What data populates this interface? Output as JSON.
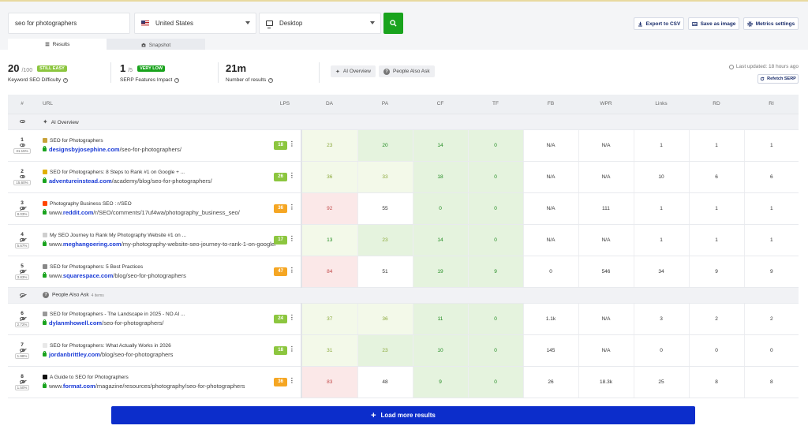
{
  "search": {
    "query": "seo for photographers",
    "country": "United States",
    "device": "Desktop"
  },
  "toolbar": {
    "export_csv": "Export to CSV",
    "save_image": "Save as image",
    "metrics_settings": "Metrics settings"
  },
  "tabs": [
    {
      "label": "Results",
      "active": true
    },
    {
      "label": "Snapshot",
      "active": false
    }
  ],
  "summary": {
    "kd": {
      "value": "20",
      "suffix": "/100",
      "badge": "STILL EASY",
      "badge_color": "#8cc63f",
      "label": "Keyword SEO Difficulty"
    },
    "serp": {
      "value": "1",
      "suffix": "/5",
      "badge": "VERY LOW",
      "badge_color": "#19a31d",
      "label": "SERP Features Impact"
    },
    "results": {
      "value": "21m",
      "label": "Number of results"
    },
    "chips": [
      "AI Overview",
      "People Also Ask"
    ],
    "last_updated": "Last updated: 18 hours ago",
    "refetch": "Refetch SERP"
  },
  "columns": [
    "#",
    "URL",
    "LPS",
    "DA",
    "PA",
    "CF",
    "TF",
    "FB",
    "WPR",
    "Links",
    "RD",
    "RI"
  ],
  "groups": {
    "ai_overview": "AI Overview",
    "people_also_ask": "People Also Ask",
    "paa_count": "4 items"
  },
  "rows": [
    {
      "pos": "1",
      "ctr": "31.15%",
      "visible": true,
      "favicon_color": "#c8a23a",
      "title": "SEO for Photographers",
      "domain": "designsbyjosephine.com",
      "prefix": "",
      "path": "/seo-for-photographers/",
      "lps": "18",
      "lps_color": "#8cc63f",
      "da": "23",
      "pa": "20",
      "cf": "14",
      "tf": "0",
      "fb": "N/A",
      "wpr": "N/A",
      "links": "1",
      "rd": "1",
      "ri": "1"
    },
    {
      "pos": "2",
      "ctr": "15.60%",
      "visible": true,
      "favicon_color": "#e0b000",
      "title": "SEO for Photographers: 8 Steps to Rank #1 on Google + ...",
      "domain": "adventureinstead.com",
      "prefix": "",
      "path": "/academy/blog/seo-for-photographers/",
      "lps": "26",
      "lps_color": "#8cc63f",
      "da": "36",
      "pa": "33",
      "cf": "18",
      "tf": "0",
      "fb": "N/A",
      "wpr": "N/A",
      "links": "10",
      "rd": "6",
      "ri": "6"
    },
    {
      "pos": "3",
      "ctr": "8.03%",
      "visible": false,
      "favicon_color": "#ff4500",
      "title": "Photography Business SEO : r/SEO",
      "domain": "reddit.com",
      "prefix": "www.",
      "path": "/r/SEO/comments/17uf4wa/photography_business_seo/",
      "lps": "36",
      "lps_color": "#f5a623",
      "da": "92",
      "pa": "55",
      "cf": "0",
      "tf": "0",
      "fb": "N/A",
      "wpr": "111",
      "links": "1",
      "rd": "1",
      "ri": "1"
    },
    {
      "pos": "4",
      "ctr": "5.67%",
      "visible": false,
      "favicon_color": "#cfcfcf",
      "title": "My SEO Journey to Rank My Photography Website #1 on ...",
      "domain": "meghangoering.com",
      "prefix": "www.",
      "path": "/my-photography-website-seo-journey-to-rank-1-on-google/",
      "lps": "17",
      "lps_color": "#8cc63f",
      "da": "13",
      "pa": "23",
      "cf": "14",
      "tf": "0",
      "fb": "N/A",
      "wpr": "N/A",
      "links": "1",
      "rd": "1",
      "ri": "1"
    },
    {
      "pos": "5",
      "ctr": "3.83%",
      "visible": false,
      "favicon_color": "#888888",
      "title": "SEO for Photographers: 5 Best Practices",
      "domain": "squarespace.com",
      "prefix": "www.",
      "path": "/blog/seo-for-photographers",
      "lps": "47",
      "lps_color": "#f5a623",
      "da": "84",
      "pa": "51",
      "cf": "19",
      "tf": "9",
      "fb": "0",
      "wpr": "546",
      "links": "34",
      "rd": "9",
      "ri": "9"
    },
    {
      "pos": "6",
      "ctr": "2.72%",
      "visible": false,
      "favicon_color": "#999999",
      "title": "SEO for Photographers - The Landscape in 2025 - NO AI ...",
      "domain": "dylanmhowell.com",
      "prefix": "",
      "path": "/seo-for-photographers/",
      "lps": "24",
      "lps_color": "#8cc63f",
      "da": "37",
      "pa": "36",
      "cf": "11",
      "tf": "0",
      "fb": "1.1k",
      "wpr": "N/A",
      "links": "3",
      "rd": "2",
      "ri": "2"
    },
    {
      "pos": "7",
      "ctr": "1.98%",
      "visible": false,
      "favicon_color": "#e8e8e8",
      "title": "SEO for Photographers: What Actually Works in 2026",
      "domain": "jordanbrittley.com",
      "prefix": "",
      "path": "/blog/seo-for-photographers",
      "lps": "18",
      "lps_color": "#8cc63f",
      "da": "31",
      "pa": "23",
      "cf": "10",
      "tf": "0",
      "fb": "145",
      "wpr": "N/A",
      "links": "0",
      "rd": "0",
      "ri": "0"
    },
    {
      "pos": "8",
      "ctr": "1.50%",
      "visible": false,
      "favicon_color": "#111111",
      "title": "A Guide to SEO for Photographers",
      "domain": "format.com",
      "prefix": "www.",
      "path": "/magazine/resources/photography/seo-for-photographers",
      "lps": "36",
      "lps_color": "#f5a623",
      "da": "83",
      "pa": "48",
      "cf": "9",
      "tf": "0",
      "fb": "26",
      "wpr": "18.3k",
      "links": "25",
      "rd": "8",
      "ri": "8"
    }
  ],
  "colors": {
    "green_light": "#f3f9e9",
    "green_mid": "#e5f3de",
    "green_deep": "#dcefd6",
    "red_light": "#fbe8e8",
    "brand_blue": "#0c2dcb",
    "go_green": "#19a31d"
  },
  "load_more": "Load more results"
}
